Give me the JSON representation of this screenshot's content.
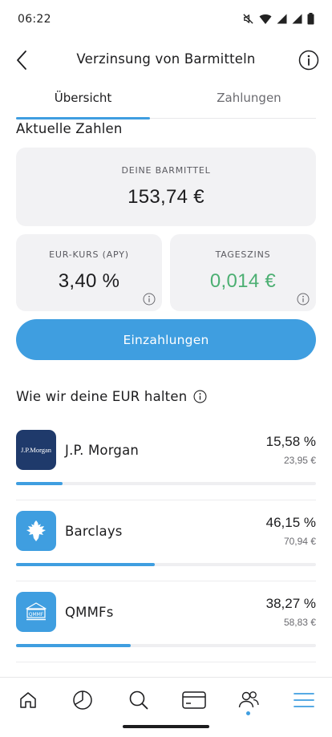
{
  "status_bar": {
    "time": "06:22"
  },
  "header": {
    "title": "Verzinsung von Barmitteln"
  },
  "tabs": [
    {
      "label": "Übersicht",
      "active": true
    },
    {
      "label": "Zahlungen",
      "active": false
    }
  ],
  "summary": {
    "title": "Aktuelle Zahlen",
    "cash": {
      "label": "DEINE BARMITTEL",
      "value": "153,74 €"
    },
    "rate": {
      "label": "EUR-KURS (APY)",
      "value": "3,40 %"
    },
    "daily": {
      "label": "TAGESZINS",
      "value": "0,014 €"
    }
  },
  "deposit_button": {
    "label": "Einzahlungen"
  },
  "holdings_section": {
    "title": "Wie wir deine EUR halten"
  },
  "holdings": [
    {
      "name": "J.P. Morgan",
      "logo_text": "J.P.Morgan",
      "percent": "15,58 %",
      "amount": "23,95 €",
      "share": 15.58,
      "logo_color": "#1f3a6b",
      "icon": "jp-morgan-logo"
    },
    {
      "name": "Barclays",
      "logo_text": "",
      "percent": "46,15 %",
      "amount": "70,94 €",
      "share": 46.15,
      "logo_color": "#3f9ee0",
      "icon": "barclays-eagle-logo"
    },
    {
      "name": "QMMFs",
      "logo_text": "QMMF",
      "percent": "38,27 %",
      "amount": "58,83 €",
      "share": 38.27,
      "logo_color": "#3f9ee0",
      "icon": "bank-building-logo"
    }
  ],
  "colors": {
    "accent": "#3f9ee0",
    "positive": "#4caf72",
    "card_bg": "#f2f2f4"
  },
  "bottom_nav": [
    {
      "icon": "home-icon"
    },
    {
      "icon": "pie-chart-icon"
    },
    {
      "icon": "search-icon"
    },
    {
      "icon": "card-icon"
    },
    {
      "icon": "people-icon"
    },
    {
      "icon": "menu-icon"
    }
  ]
}
